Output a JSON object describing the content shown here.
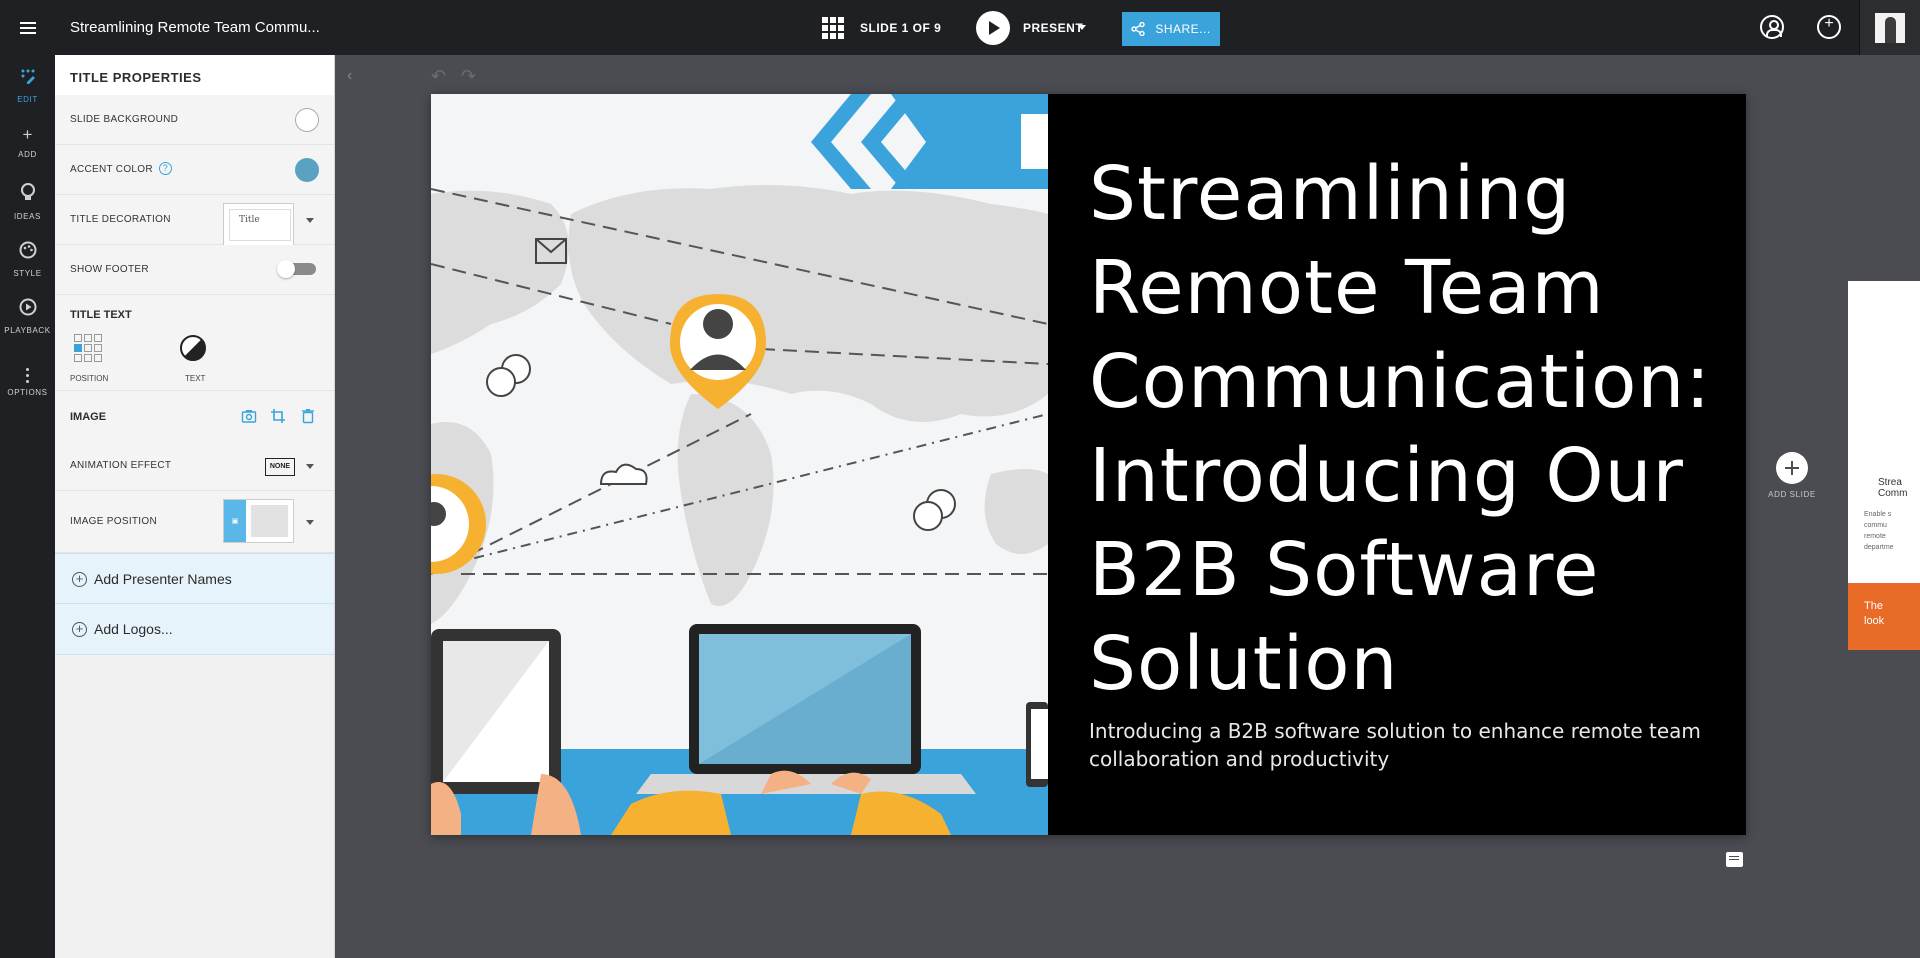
{
  "topbar": {
    "doc_title": "Streamlining Remote Team Commu...",
    "slide_count": "SLIDE 1 OF 9",
    "present_label": "PRESENT",
    "share_label": "SHARE..."
  },
  "leftnav": {
    "items": [
      {
        "label": "EDIT",
        "icon": "edit-icon"
      },
      {
        "label": "ADD",
        "icon": "plus-icon"
      },
      {
        "label": "IDEAS",
        "icon": "lightbulb-icon"
      },
      {
        "label": "STYLE",
        "icon": "palette-icon"
      },
      {
        "label": "PLAYBACK",
        "icon": "play-icon"
      },
      {
        "label": "OPTIONS",
        "icon": "kebab-icon"
      }
    ]
  },
  "panel": {
    "header": "TITLE PROPERTIES",
    "slide_background": "SLIDE BACKGROUND",
    "accent_color": "ACCENT COLOR",
    "accent_hex": "#5aa2c2",
    "title_decoration": "TITLE DECORATION",
    "title_decoration_preview": "Title",
    "show_footer": "SHOW FOOTER",
    "title_text": "TITLE TEXT",
    "position_label": "POSITION",
    "text_label": "TEXT",
    "image": "IMAGE",
    "animation_effect": "ANIMATION EFFECT",
    "animation_value": "NONE",
    "image_position": "IMAGE POSITION",
    "add_presenter": "Add Presenter Names",
    "add_logos": "Add Logos..."
  },
  "slide": {
    "title": "Streamlining Remote Team Communication: Introducing Our B2B Software Solution",
    "subtitle": "Introducing a B2B software solution to enhance remote team collaboration and productivity"
  },
  "canvas": {
    "add_slide": "ADD SLIDE"
  },
  "next_slide": {
    "title_fragment": "Strea\nComm",
    "body_fragment": "Enable s\ncommu\nremote\ndepartme",
    "bottom_fragment": "The\nlook"
  }
}
